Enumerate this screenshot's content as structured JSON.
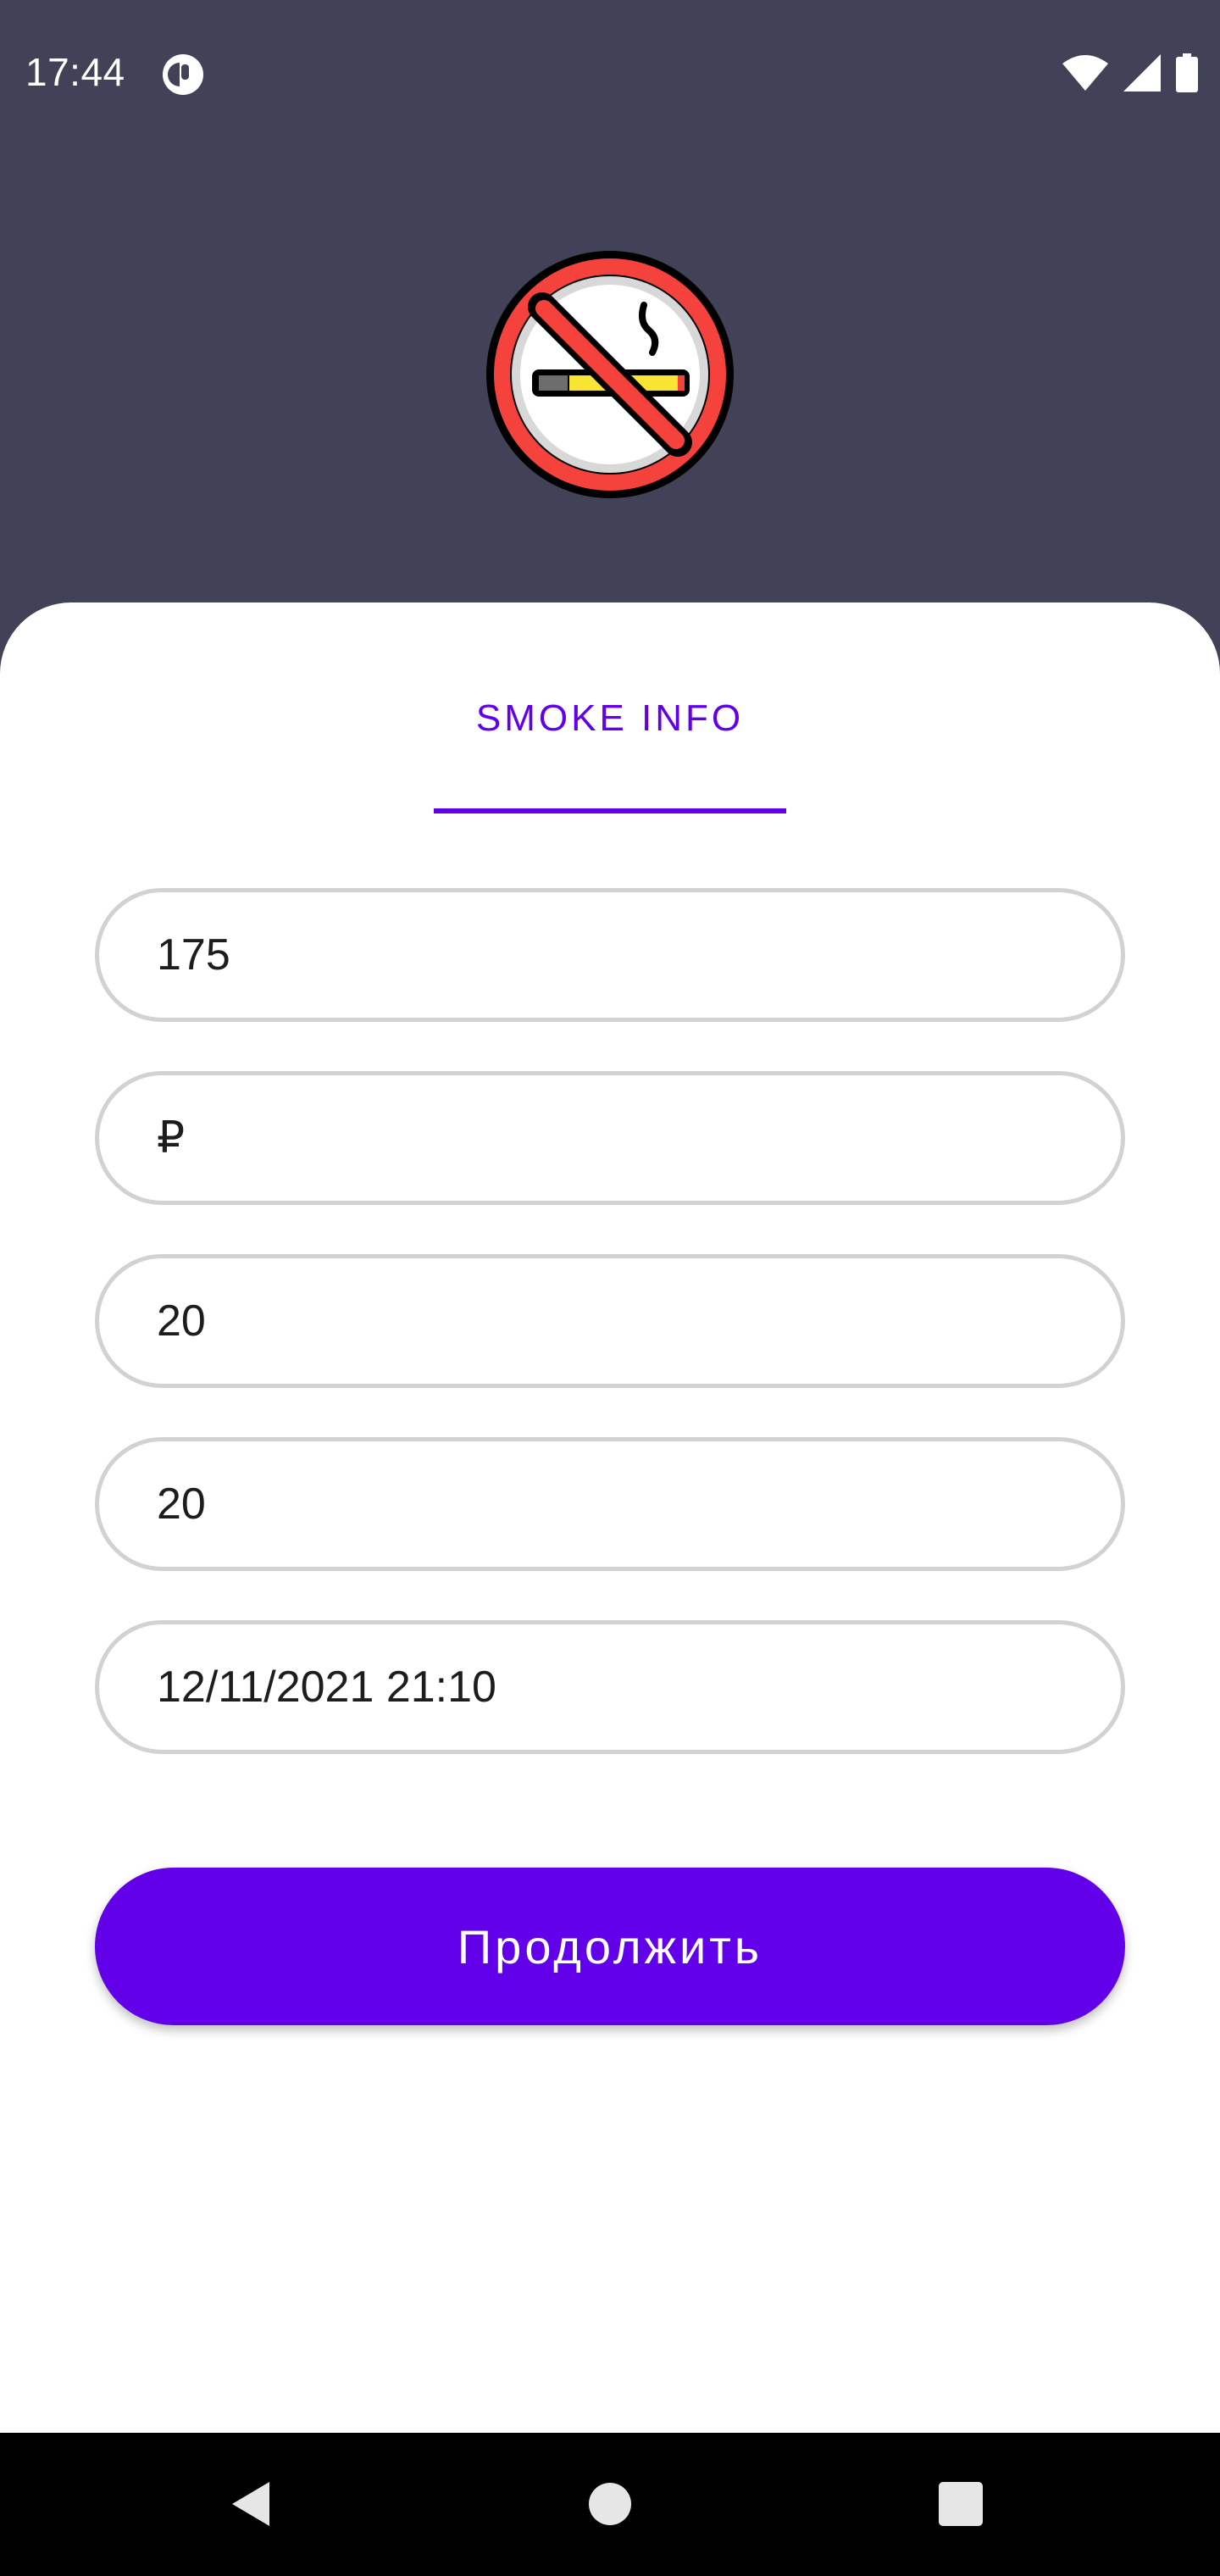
{
  "status_bar": {
    "time": "17:44",
    "icons": [
      "app-notification-icon",
      "wifi-icon",
      "cell-signal-icon",
      "battery-icon"
    ]
  },
  "header": {
    "logo_icon": "no-smoking-icon"
  },
  "tab": {
    "label": "SMOKE INFO"
  },
  "form": {
    "fields": [
      {
        "value": "175"
      },
      {
        "value": "₽"
      },
      {
        "value": "20"
      },
      {
        "value": "20"
      },
      {
        "value": "12/11/2021 21:10"
      }
    ],
    "continue_label": "Продолжить"
  },
  "nav_bar": {
    "icons": [
      "back-icon",
      "home-icon",
      "recents-icon"
    ]
  },
  "colors": {
    "header_background": "#414257",
    "accent": "#6200ea",
    "field_border": "#d2d2d2",
    "no_smoking_red": "#f5423c",
    "cigarette_yellow": "#f7e433"
  }
}
